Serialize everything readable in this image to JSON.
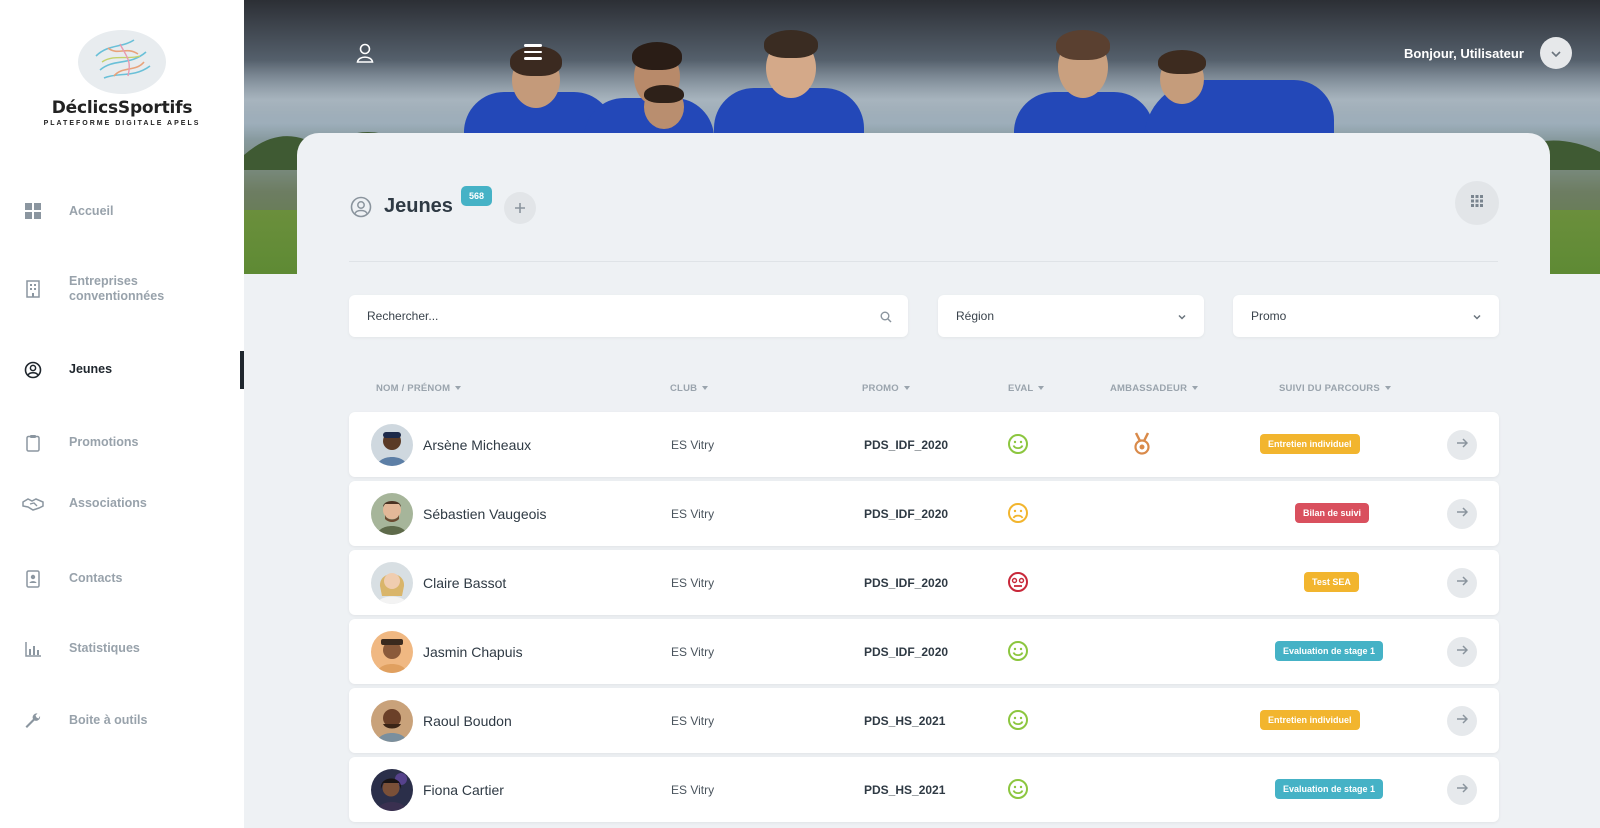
{
  "brand": {
    "name": "DéclicsSportifs",
    "tagline": "PLATEFORME DIGITALE APELS"
  },
  "sidebar": {
    "items": [
      {
        "label": "Accueil",
        "icon": "dashboard-icon"
      },
      {
        "label": "Entreprises conventionnées",
        "icon": "building-icon"
      },
      {
        "label": "Jeunes",
        "icon": "user-circle-icon",
        "active": true
      },
      {
        "label": "Promotions",
        "icon": "clipboard-icon"
      },
      {
        "label": "Associations",
        "icon": "handshake-icon"
      },
      {
        "label": "Contacts",
        "icon": "contact-card-icon"
      },
      {
        "label": "Statistiques",
        "icon": "bar-chart-icon"
      },
      {
        "label": "Boite à outils",
        "icon": "wrench-icon"
      }
    ]
  },
  "header": {
    "greeting": "Bonjour, Utilisateur"
  },
  "page": {
    "title": "Jeunes",
    "count": "568"
  },
  "filters": {
    "search_placeholder": "Rechercher...",
    "region_label": "Région",
    "promo_label": "Promo"
  },
  "table": {
    "columns": [
      "NOM / PRÉNOM",
      "CLUB",
      "PROMO",
      "EVAL",
      "AMBASSADEUR",
      "SUIVI DU PARCOURS"
    ],
    "rows": [
      {
        "name": "Arsène Micheaux",
        "club": "ES Vitry",
        "promo": "PDS_IDF_2020",
        "eval": "happy",
        "ambassador": true,
        "status": "Entretien individuel",
        "status_color": "#f2b52e"
      },
      {
        "name": "Sébastien Vaugeois",
        "club": "ES Vitry",
        "promo": "PDS_IDF_2020",
        "eval": "sad",
        "ambassador": false,
        "status": "Bilan de suivi",
        "status_color": "#d9505e"
      },
      {
        "name": "Claire Bassot",
        "club": "ES Vitry",
        "promo": "PDS_IDF_2020",
        "eval": "angry",
        "ambassador": false,
        "status": "Test SEA",
        "status_color": "#f2b52e"
      },
      {
        "name": "Jasmin Chapuis",
        "club": "ES Vitry",
        "promo": "PDS_IDF_2020",
        "eval": "happy",
        "ambassador": false,
        "status": "Evaluation de stage 1",
        "status_color": "#45b2c6"
      },
      {
        "name": "Raoul Boudon",
        "club": "ES Vitry",
        "promo": "PDS_HS_2021",
        "eval": "happy",
        "ambassador": false,
        "status": "Entretien individuel",
        "status_color": "#f2b52e"
      },
      {
        "name": "Fiona Cartier",
        "club": "ES Vitry",
        "promo": "PDS_HS_2021",
        "eval": "happy",
        "ambassador": false,
        "status": "Evaluation de stage 1",
        "status_color": "#45b2c6"
      }
    ]
  },
  "colors": {
    "accent": "#45b2c6",
    "warning": "#f2b52e",
    "danger": "#d9505e",
    "happy": "#8cc63f",
    "sad": "#f2b52e",
    "angry": "#c8283a",
    "medal": "#d98a4a"
  }
}
